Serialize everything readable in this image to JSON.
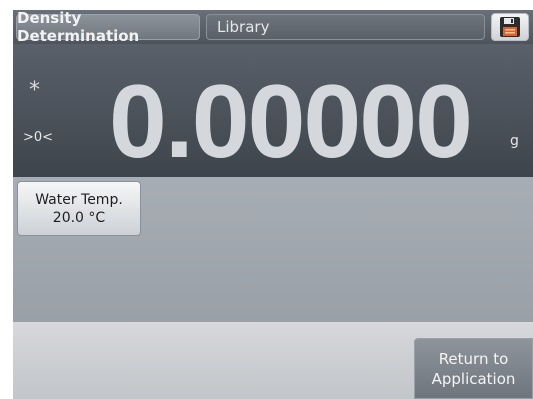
{
  "topbar": {
    "app_tab_label": "Density Determination",
    "library_tab_label": "Library",
    "save_icon": "floppy-disk-icon"
  },
  "display": {
    "stable_indicator": "*",
    "zero_indicator": ">0<",
    "reading": "0.00000",
    "unit": "g"
  },
  "work": {
    "water_temp_label": "Water Temp.",
    "water_temp_value": "20.0 °C"
  },
  "bottombar": {
    "return_line1": "Return to",
    "return_line2": "Application"
  },
  "colors": {
    "topbar": "#5d636b",
    "display_bg": "#4c525a",
    "reading_text": "#d4d8dc",
    "work_bg": "#a2a8af",
    "bottom_bg": "#cccfd2",
    "return_button": "#7f858c"
  }
}
